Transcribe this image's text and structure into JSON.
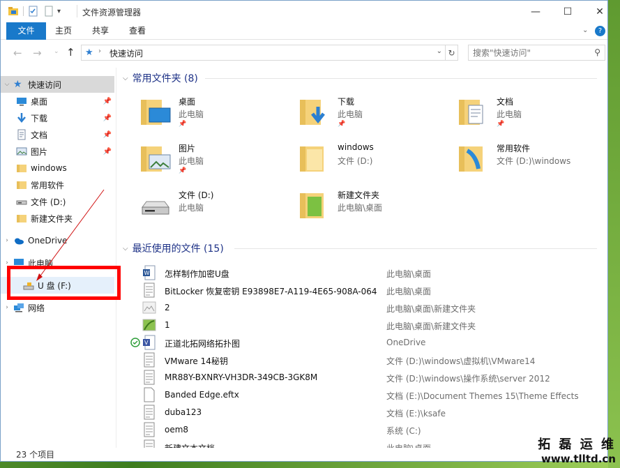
{
  "window": {
    "title": "文件资源管理器",
    "minimize": "—",
    "maximize": "☐",
    "close": "✕"
  },
  "ribbon": {
    "tabs": [
      "文件",
      "主页",
      "共享",
      "查看"
    ]
  },
  "address": {
    "path": "快速访问",
    "search_placeholder": "搜索\"快速访问\""
  },
  "sidebar": {
    "quick_access": "快速访问",
    "items": [
      {
        "label": "桌面",
        "icon": "desktop-icon",
        "pinned": true
      },
      {
        "label": "下载",
        "icon": "download-icon",
        "pinned": true
      },
      {
        "label": "文档",
        "icon": "document-icon",
        "pinned": true
      },
      {
        "label": "图片",
        "icon": "picture-icon",
        "pinned": true
      },
      {
        "label": "windows",
        "icon": "folder-icon",
        "pinned": false
      },
      {
        "label": "常用软件",
        "icon": "folder-icon",
        "pinned": false
      },
      {
        "label": "文件 (D:)",
        "icon": "drive-icon",
        "pinned": false
      },
      {
        "label": "新建文件夹",
        "icon": "folder-icon",
        "pinned": false
      }
    ],
    "onedrive": "OneDrive",
    "this_pc": "此电脑",
    "usb": "U 盘 (F:)",
    "network": "网络"
  },
  "frequent": {
    "header": "常用文件夹 (8)",
    "items": [
      {
        "name": "桌面",
        "sub": "此电脑",
        "pinned": true,
        "icon": "desktop-folder-icon"
      },
      {
        "name": "下载",
        "sub": "此电脑",
        "pinned": true,
        "icon": "download-folder-icon"
      },
      {
        "name": "文档",
        "sub": "此电脑",
        "pinned": true,
        "icon": "document-folder-icon"
      },
      {
        "name": "图片",
        "sub": "此电脑",
        "pinned": true,
        "icon": "picture-folder-icon"
      },
      {
        "name": "windows",
        "sub": "文件 (D:)",
        "pinned": false,
        "icon": "folder-icon"
      },
      {
        "name": "常用软件",
        "sub": "文件 (D:)\\windows",
        "pinned": false,
        "icon": "folder-icon"
      },
      {
        "name": "文件 (D:)",
        "sub": "此电脑",
        "pinned": false,
        "icon": "drive-icon"
      },
      {
        "name": "新建文件夹",
        "sub": "此电脑\\桌面",
        "pinned": false,
        "icon": "folder-icon"
      }
    ]
  },
  "recent": {
    "header": "最近使用的文件 (15)",
    "items": [
      {
        "name": "怎样制作加密U盘",
        "path": "此电脑\\桌面",
        "icon": "word-icon",
        "status": ""
      },
      {
        "name": "BitLocker 恢复密钥 E93898E7-A119-4E65-908A-064...",
        "path": "此电脑\\桌面",
        "icon": "text-file-icon",
        "status": ""
      },
      {
        "name": "2",
        "path": "此电脑\\桌面\\新建文件夹",
        "icon": "image-file-icon",
        "status": ""
      },
      {
        "name": "1",
        "path": "此电脑\\桌面\\新建文件夹",
        "icon": "image-file-icon",
        "status": ""
      },
      {
        "name": "正道北拓网络拓扑图",
        "path": "OneDrive",
        "icon": "visio-icon",
        "status": "synced-check-icon"
      },
      {
        "name": "VMware 14秘钥",
        "path": "文件 (D:)\\windows\\虚拟机\\VMware14",
        "icon": "text-file-icon",
        "status": ""
      },
      {
        "name": "MR88Y-BXNRY-VH3DR-349CB-3GK8M",
        "path": "文件 (D:)\\windows\\操作系统\\server 2012",
        "icon": "text-file-icon",
        "status": ""
      },
      {
        "name": "Banded Edge.eftx",
        "path": "文档 (E:)\\Document Themes 15\\Theme Effects",
        "icon": "blank-file-icon",
        "status": ""
      },
      {
        "name": "duba123",
        "path": "文档 (E:)\\ksafe",
        "icon": "text-file-icon",
        "status": ""
      },
      {
        "name": "oem8",
        "path": "系统 (C:)",
        "icon": "text-file-icon",
        "status": ""
      },
      {
        "name": "新建文本文档",
        "path": "此电脑\\桌面",
        "icon": "text-file-icon",
        "status": ""
      }
    ]
  },
  "status": {
    "count": "23 个项目"
  },
  "watermark": {
    "line1": "拓 磊 运 维",
    "line2": "www.tlltd.cn"
  },
  "colors": {
    "accent": "#1979ca",
    "header": "#1e3287",
    "selection": "#d9d9d9",
    "highlight_box": "#ff0000"
  }
}
